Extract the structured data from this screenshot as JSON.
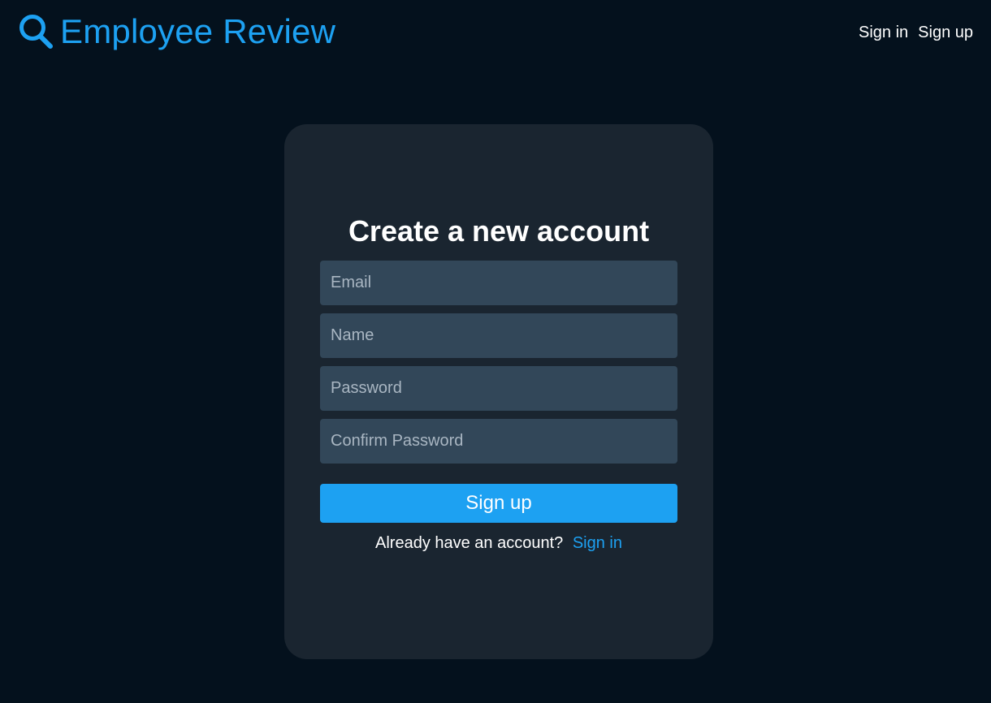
{
  "header": {
    "brand_icon": "search-icon",
    "brand_title": "Employee Review",
    "nav": [
      {
        "label": "Sign in"
      },
      {
        "label": "Sign up"
      }
    ]
  },
  "form": {
    "title": "Create a new account",
    "fields": {
      "email": {
        "placeholder": "Email",
        "value": ""
      },
      "name": {
        "placeholder": "Name",
        "value": ""
      },
      "password": {
        "placeholder": "Password",
        "value": ""
      },
      "confirm_password": {
        "placeholder": "Confirm Password",
        "value": ""
      }
    },
    "submit_label": "Sign up",
    "footer": {
      "prompt": "Already have an account?",
      "link_label": "Sign in"
    }
  },
  "colors": {
    "background": "#04111d",
    "card": "#1a2530",
    "input": "#324759",
    "accent": "#1da1f2"
  }
}
